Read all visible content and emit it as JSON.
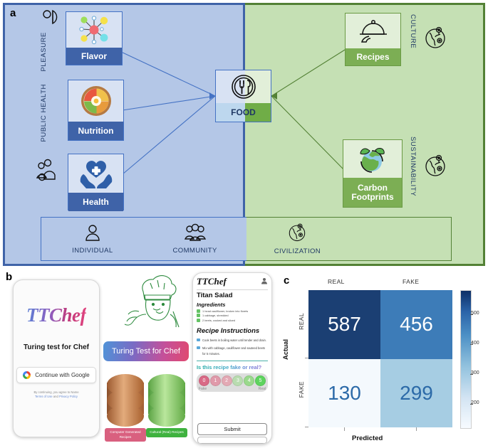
{
  "figure": {
    "panel_a_letter": "a",
    "panel_b_letter": "b",
    "panel_c_letter": "c"
  },
  "panel_a": {
    "side_labels": [
      {
        "id": "pleasure",
        "text": "PLEASURE",
        "icon": "taste-tongue-icon"
      },
      {
        "id": "public-health",
        "text": "PUBLIC HEALTH",
        "icon": "people-group-icon"
      }
    ],
    "right_labels": [
      {
        "id": "culture",
        "text": "CULTURE",
        "icon": "globe-icon"
      },
      {
        "id": "sustainability",
        "text": "SUSTAINABILITY",
        "icon": "globe-icon"
      }
    ],
    "left_nodes": [
      {
        "id": "flavor",
        "label": "Flavor",
        "icon": "molecule-network-icon"
      },
      {
        "id": "nutrition",
        "label": "Nutrition",
        "icon": "salad-bowl-icon"
      },
      {
        "id": "health",
        "label": "Health",
        "icon": "heart-in-hands-icon"
      }
    ],
    "center_node": {
      "id": "food",
      "label": "FOOD",
      "icon": "plate-fork-spoon-icon"
    },
    "right_nodes": [
      {
        "id": "recipes",
        "label": "Recipes",
        "icon": "cloche-serving-tray-icon"
      },
      {
        "id": "carbon",
        "label": "Carbon\nFootprints",
        "label_line1": "Carbon",
        "label_line2": "Footprints",
        "icon": "earth-leaves-icon"
      }
    ],
    "scale_band": [
      {
        "id": "individual",
        "text": "INDIVIDUAL",
        "icon": "person-icon"
      },
      {
        "id": "community",
        "text": "COMMUNITY",
        "icon": "people-group-icon"
      },
      {
        "id": "civilization",
        "text": "CIVILIZATION",
        "icon": "globe-icon"
      }
    ],
    "colors": {
      "blue_bg": "#b4c7e7",
      "blue_border": "#3f63a8",
      "green_bg": "#c5e0b4",
      "green_border": "#538135",
      "node_blue_caption": "#3f63a8",
      "node_green_caption": "#7cae54"
    }
  },
  "panel_b": {
    "phone_login": {
      "logo": "TTChef",
      "tagline": "Turing test for Chef",
      "google_button": "Continue with Google",
      "fineprint_line1": "By continuing, you agree to Name",
      "fineprint_terms": "Terms of Use",
      "fineprint_and": " and ",
      "fineprint_privacy": "Privacy Policy"
    },
    "middle": {
      "chef_sketch_alt": "chef-line-drawing-icon",
      "banner": "Turing Test for Chef",
      "databases": [
        {
          "id": "computer-generated",
          "label": "Computer Generated Recipes",
          "color": "#d9607f",
          "cylinder": "copper"
        },
        {
          "id": "cultural-real",
          "label": "Cultural (Real) Recipes",
          "color": "#3fb23f",
          "cylinder": "green"
        }
      ]
    },
    "phone_recipe": {
      "logo": "TTChef",
      "account_icon": "user-avatar-icon",
      "recipe_title": "Titan Salad",
      "ingredients_heading": "Ingredients",
      "ingredients": [
        "1 head cauliflower, broken into florets",
        "1 cabbage, shredded",
        "2 beets, cooked and sliced"
      ],
      "instructions_heading": "Recipe Instructions",
      "instructions": [
        "Cook beets in boiling water until tender and drain.",
        "Mix with cabbage, cauliflower and sauteed beets for 5 minutes."
      ],
      "question": "Is this recipe fake or real?",
      "scale": [
        "0",
        "1",
        "2",
        "3",
        "4",
        "5"
      ],
      "scale_left_label": "Fake",
      "scale_right_label": "Real",
      "submit_label": "Submit"
    }
  },
  "chart_data": {
    "type": "heatmap",
    "subtype": "confusion-matrix",
    "title": "",
    "xlabel": "Predicted",
    "ylabel": "Actual",
    "categories_x": [
      "REAL",
      "FAKE"
    ],
    "categories_y": [
      "REAL",
      "FAKE"
    ],
    "matrix": [
      [
        587,
        456
      ],
      [
        130,
        299
      ]
    ],
    "cells": [
      {
        "actual": "REAL",
        "predicted": "REAL",
        "value": 587,
        "color": "#1b3f73",
        "text_color": "#ffffff"
      },
      {
        "actual": "REAL",
        "predicted": "FAKE",
        "value": 456,
        "color": "#3d7cb8",
        "text_color": "#ffffff"
      },
      {
        "actual": "FAKE",
        "predicted": "REAL",
        "value": 130,
        "color": "#f4f9fd",
        "text_color": "#2c6aa8"
      },
      {
        "actual": "FAKE",
        "predicted": "FAKE",
        "value": 299,
        "color": "#a6cde3",
        "text_color": "#2c6aa8"
      }
    ],
    "colorbar": {
      "ticks": [
        "500",
        "400",
        "300",
        "200"
      ],
      "tick_values": [
        500,
        400,
        300,
        200
      ],
      "range": [
        130,
        587
      ],
      "colormap": "Blues",
      "position": "right"
    },
    "grid": false,
    "legend": "colorbar"
  }
}
